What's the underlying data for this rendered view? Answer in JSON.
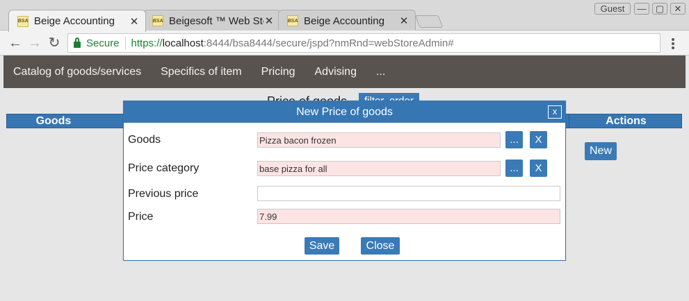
{
  "window": {
    "user_badge": "Guest",
    "controls": [
      "—",
      "▢",
      "✕"
    ]
  },
  "tabs": [
    {
      "label": "Beige Accounting",
      "favicon": "BSA",
      "close": "✕",
      "active": true
    },
    {
      "label": "Beigesoft ™ Web Sto",
      "favicon": "BSA",
      "close": "✕",
      "active": false
    },
    {
      "label": "Beige Accounting",
      "favicon": "BSA",
      "close": "✕",
      "active": false
    }
  ],
  "addressbar": {
    "secure_label": "Secure",
    "url_scheme": "https://",
    "url_host": "localhost",
    "url_rest": ":8444/bsa8444/secure/jspd?nmRnd=webStoreAdmin#",
    "back_icon": "←",
    "forward_icon": "→",
    "reload_icon": "↻"
  },
  "navbar": {
    "items": [
      "Catalog of goods/services",
      "Specifics of item",
      "Pricing",
      "Advising",
      "..."
    ]
  },
  "page": {
    "title": "Price of goods",
    "filter_button": "filter, order",
    "table_headers": [
      "Goods",
      "Actions"
    ],
    "new_button": "New"
  },
  "dialog": {
    "title": "New Price of goods",
    "close_label": "x",
    "fields": {
      "goods": {
        "label": "Goods",
        "value": "Pizza bacon frozen"
      },
      "price_category": {
        "label": "Price category",
        "value": "base pizza for all"
      },
      "previous_price": {
        "label": "Previous price",
        "value": ""
      },
      "price": {
        "label": "Price",
        "value": "7.99"
      }
    },
    "picker_label": "...",
    "clear_label": "X",
    "save_button": "Save",
    "close_button": "Close"
  },
  "colors": {
    "accent": "#3576b3",
    "navbar_bg": "#58534f",
    "required_field_bg": "#fde4e4",
    "secure_green": "#1e7e34"
  }
}
